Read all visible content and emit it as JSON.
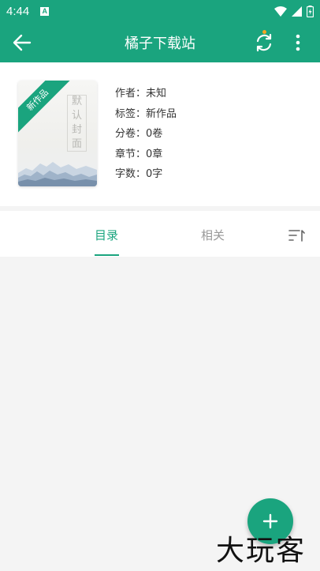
{
  "status_bar": {
    "time": "4:44",
    "icons": [
      "a-notification-icon",
      "wifi-icon",
      "signal-icon",
      "battery-icon"
    ]
  },
  "toolbar": {
    "title": "橘子下载站",
    "back_icon": "arrow-left-icon",
    "sync_icon": "sync-icon",
    "more_icon": "more-vertical-icon"
  },
  "book": {
    "ribbon": "新作品",
    "cover_title_chars": [
      "默",
      "认",
      "封",
      "面"
    ],
    "meta": [
      "作者：未知",
      "标签：新作品",
      "分卷：0卷",
      "章节：0章",
      "字数：0字"
    ]
  },
  "tabs": {
    "catalog": "目录",
    "related": "相关",
    "active": "catalog",
    "sort_icon": "sort-icon"
  },
  "fab": {
    "icon": "plus-icon"
  },
  "watermark": "大玩客",
  "colors": {
    "accent": "#1aa47e",
    "badge_dot": "#f5a623",
    "background": "#f4f4f4"
  }
}
